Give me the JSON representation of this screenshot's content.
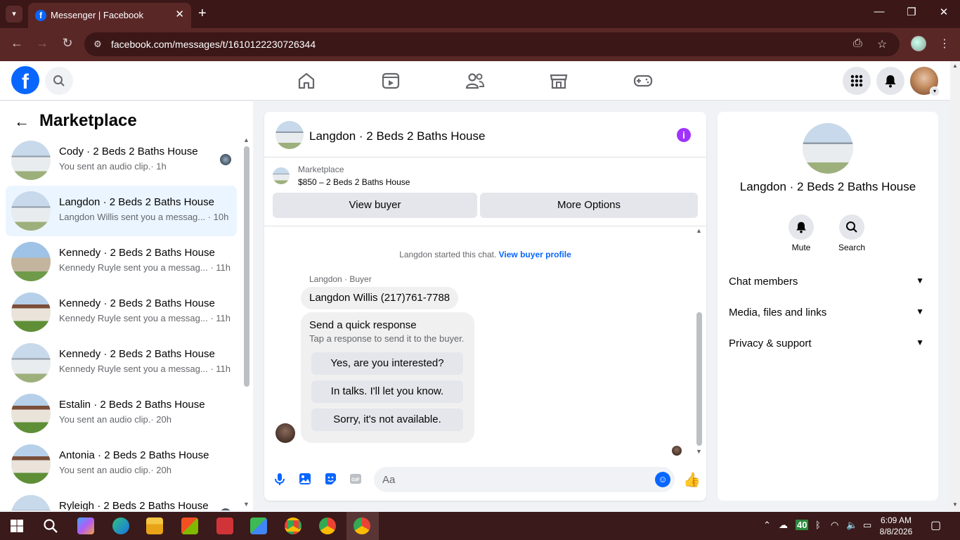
{
  "browser": {
    "tab_title": "Messenger | Facebook",
    "tab_close": "✕",
    "new_tab": "+",
    "url": "facebook.com/messages/t/1610122230726344",
    "window_min": "—",
    "window_max": "❐",
    "window_close": "✕"
  },
  "sidebar": {
    "title": "Marketplace",
    "back": "←",
    "conversations": [
      {
        "title": "Cody · 2 Beds 2 Baths House",
        "preview": "You sent an audio clip.· 1h",
        "thumb": "house1"
      },
      {
        "title": "Langdon · 2 Beds 2 Baths House",
        "preview": "Langdon Willis sent you a messag... · 10h",
        "thumb": "house1",
        "selected": true
      },
      {
        "title": "Kennedy · 2 Beds 2 Baths House",
        "preview": "Kennedy Ruyle sent you a messag... · 11h",
        "thumb": "house2"
      },
      {
        "title": "Kennedy · 2 Beds 2 Baths House",
        "preview": "Kennedy Ruyle sent you a messag... · 11h",
        "thumb": "house3"
      },
      {
        "title": "Kennedy · 2 Beds 2 Baths House",
        "preview": "Kennedy Ruyle sent you a messag... · 11h",
        "thumb": "house1"
      },
      {
        "title": "Estalin · 2 Beds 2 Baths House",
        "preview": "You sent an audio clip.· 20h",
        "thumb": "house3"
      },
      {
        "title": "Antonia · 2 Beds 2 Baths House",
        "preview": "You sent an audio clip.· 20h",
        "thumb": "house3"
      },
      {
        "title": "Ryleigh · 2 Beds 2 Baths House",
        "preview": "",
        "thumb": "house1"
      }
    ]
  },
  "chat": {
    "title": "Langdon · 2 Beds 2 Baths House",
    "info_icon": "i",
    "marketplace_label": "Marketplace",
    "listing": "$850 – 2 Beds 2 Baths House",
    "view_buyer": "View buyer",
    "more_options": "More Options",
    "started_text": "Langdon started this chat.",
    "view_buyer_profile": "View buyer profile",
    "sender_label": "Langdon · Buyer",
    "message": "Langdon Willis (217)761-7788",
    "quick_title": "Send a quick response",
    "quick_subtitle": "Tap a response to send it to the buyer.",
    "quick_responses": [
      "Yes, are you interested?",
      "In talks. I'll let you know.",
      "Sorry, it's not available."
    ],
    "composer_placeholder": "Aa"
  },
  "details": {
    "title": "Langdon · 2 Beds 2 Baths House",
    "mute": "Mute",
    "search": "Search",
    "sections": [
      "Chat members",
      "Media, files and links",
      "Privacy & support"
    ]
  },
  "taskbar": {
    "time": "6:09 AM",
    "date": "8/8/2026",
    "battery": "40"
  },
  "colors": {
    "brand": "#0866ff",
    "info": "#a033ff",
    "browser_bg": "#3b1717"
  }
}
